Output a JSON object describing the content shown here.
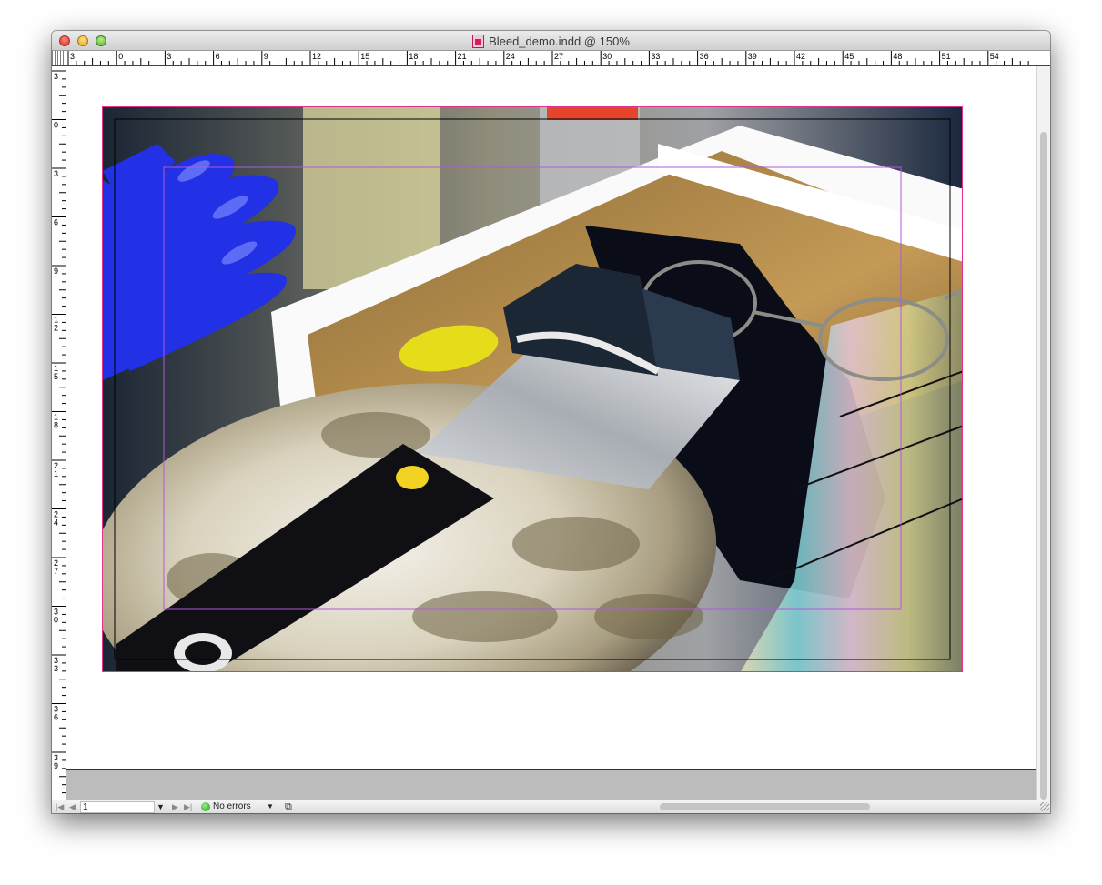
{
  "window": {
    "title": "Bleed_demo.indd @ 150%"
  },
  "rulers": {
    "horizontal_ticks": [
      "3",
      "0",
      "3",
      "6",
      "9",
      "12",
      "15",
      "18",
      "21",
      "24",
      "27",
      "30",
      "33",
      "36",
      "39",
      "42",
      "45",
      "48",
      "51",
      "54"
    ],
    "vertical_ticks": [
      "3",
      "0",
      "3",
      "6",
      "9",
      "12",
      "15",
      "18",
      "21",
      "24",
      "27",
      "30",
      "33",
      "36",
      "39"
    ]
  },
  "statusbar": {
    "first_page_icon": "first-page-icon",
    "prev_page_icon": "previous-page-icon",
    "page_number": "1",
    "page_menu_icon": "chevron-down-icon",
    "next_page_icon": "next-page-icon",
    "last_page_icon": "last-page-icon",
    "preflight_status": "No errors",
    "preflight_menu_icon": "chevron-down-icon",
    "open_doc_icon": "document-open-icon"
  },
  "colors": {
    "bleed_guide": "#e0338d",
    "margin_guide": "#b05ad8",
    "trim_line": "#000000",
    "status_ok": "#1d9a17"
  }
}
